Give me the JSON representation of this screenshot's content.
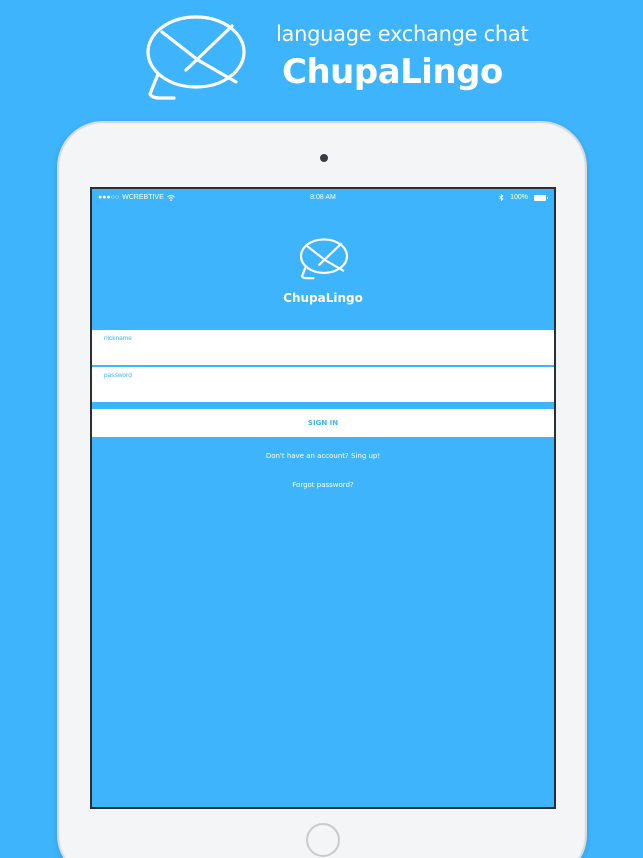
{
  "promo": {
    "tagline": "language exchange chat",
    "brand": "ChupaLingo",
    "logo_icon": "chat-envelope-logo"
  },
  "colors": {
    "background": "#3db4fb",
    "accent": "#3db4fb",
    "field_bg": "#ffffff",
    "text_on_blue": "#ffffff"
  },
  "statusbar": {
    "signal": "●●●○○",
    "carrier": "WCREBTIVE",
    "wifi_icon": "wifi-icon",
    "time": "8:08 AM",
    "bluetooth_icon": "bluetooth-icon",
    "battery": "100%"
  },
  "app": {
    "title": "ChupaLingo",
    "logo_icon": "chat-envelope-logo"
  },
  "form": {
    "nickname_label": "nickname",
    "nickname_value": "",
    "password_label": "password",
    "password_value": "",
    "signin_label": "SIGN IN",
    "signup_link": "Don't have an account? Sing up!",
    "forgot_link": "Forgot password?"
  }
}
